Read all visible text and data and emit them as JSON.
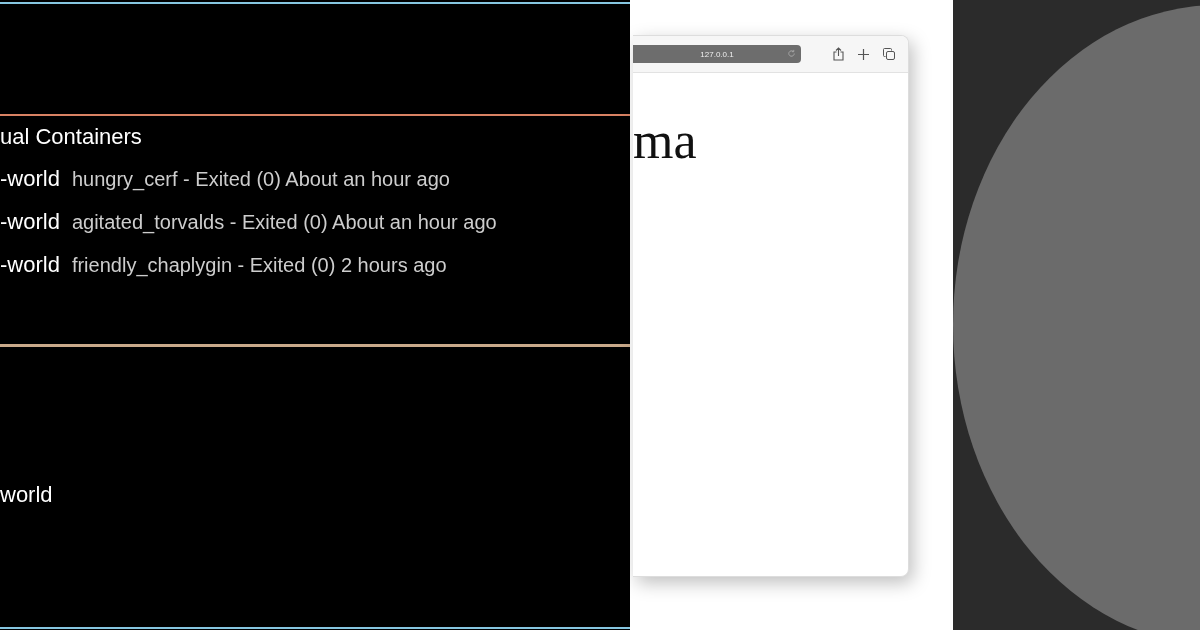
{
  "containers_panel": {
    "section_title": "ual Containers",
    "containers": [
      {
        "image": "-world",
        "details": "hungry_cerf - Exited (0) About an hour ago"
      },
      {
        "image": "-world",
        "details": "agitated_torvalds - Exited (0) About an hour ago"
      },
      {
        "image": "-world",
        "details": "friendly_chaplygin - Exited (0) 2 hours ago"
      }
    ]
  },
  "lower_panel": {
    "items": [
      {
        "label": "world"
      }
    ]
  },
  "browser": {
    "address": "127.0.0.1",
    "page_heading": "ma"
  }
}
